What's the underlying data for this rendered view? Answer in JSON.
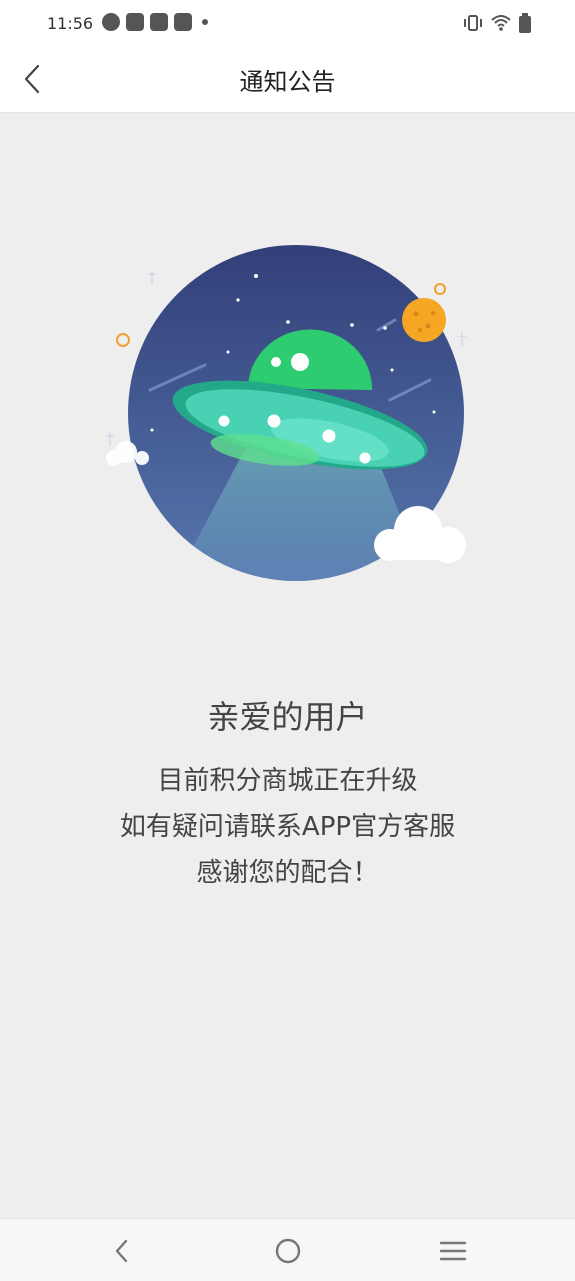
{
  "status_bar": {
    "time": "11:56",
    "left_icons": [
      "compass-icon",
      "bag-icon",
      "bag-icon",
      "bag-icon",
      "dot-icon"
    ],
    "right_icons": [
      "vibrate-icon",
      "wifi-icon",
      "battery-icon"
    ]
  },
  "header": {
    "title": "通知公告",
    "back_icon": "back-chevron-icon"
  },
  "illustration": {
    "subject": "ufo-illustration",
    "colors": {
      "sky": "#3f5693",
      "ufo_dome": "#2ecc71",
      "ufo_disc": "#48d1b3",
      "moon": "#f5a623"
    }
  },
  "notice": {
    "heading": "亲爱的用户",
    "lines": [
      "目前积分商城正在升级",
      "如有疑问请联系APP官方客服",
      "感谢您的配合！"
    ]
  },
  "system_nav": {
    "buttons": [
      "back-icon",
      "home-icon",
      "menu-icon"
    ]
  }
}
